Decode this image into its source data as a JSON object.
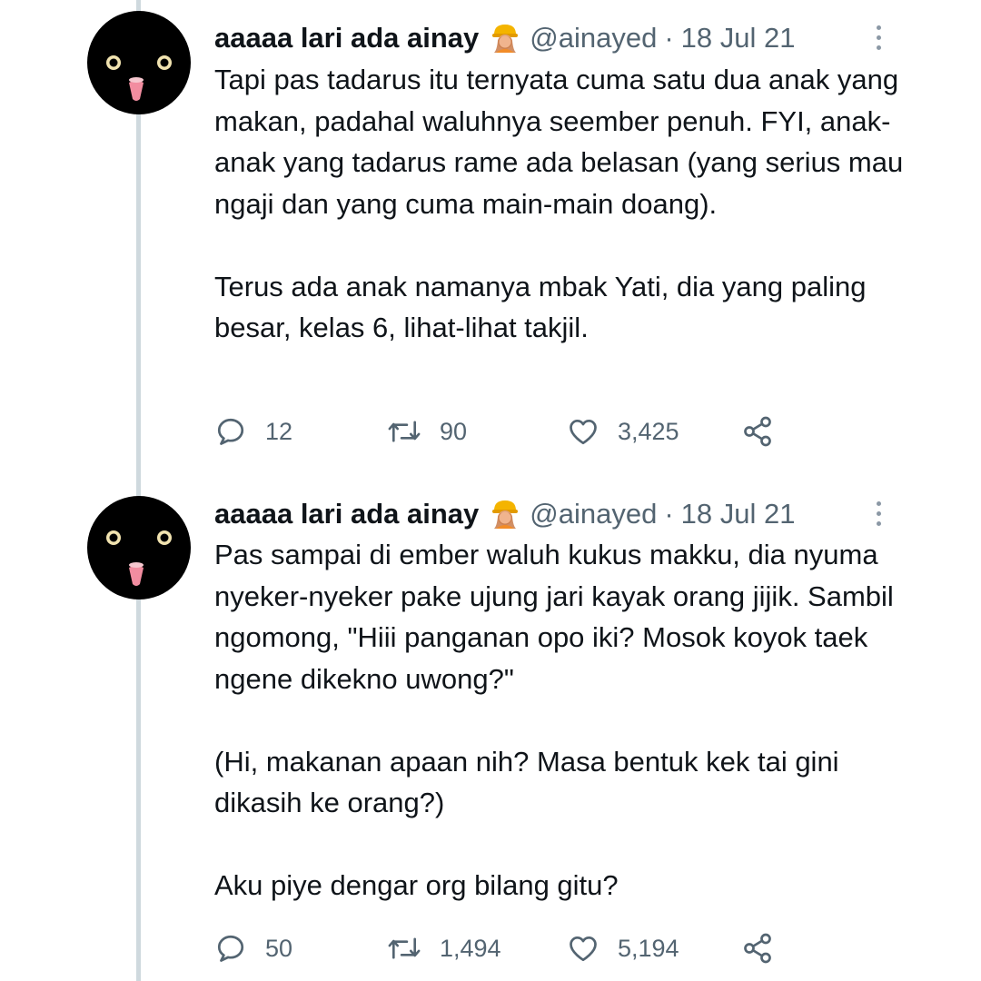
{
  "tweets": [
    {
      "author_name": "aaaaa lari ada ainay",
      "handle": "@ainayed",
      "separator": "·",
      "date": "18 Jul 21",
      "paragraphs": [
        "Tapi pas tadarus itu ternyata cuma satu dua anak yang makan, padahal waluhnya seember penuh. FYI, anak-anak yang tadarus rame ada belasan (yang serius mau ngaji dan yang cuma main-main doang).",
        "Terus ada anak namanya mbak Yati, dia yang paling besar, kelas 6, lihat-lihat takjil."
      ],
      "replies": "12",
      "retweets": "90",
      "likes": "3,425"
    },
    {
      "author_name": "aaaaa lari ada ainay",
      "handle": "@ainayed",
      "separator": "·",
      "date": "18 Jul 21",
      "paragraphs": [
        "Pas sampai di ember waluh kukus makku, dia nyuma nyeker-nyeker pake ujung jari kayak orang jijik. Sambil ngomong, \"Hiii panganan opo iki? Mosok koyok taek ngene dikekno uwong?\"",
        "(Hi, makanan apaan nih? Masa bentuk kek tai gini dikasih ke orang?)",
        "Aku piye dengar org bilang gitu?"
      ],
      "replies": "50",
      "retweets": "1,494",
      "likes": "5,194"
    }
  ],
  "icons": {
    "avatar": "black-face-avatar",
    "emoji": "construction-worker-emoji",
    "more": "more-vertical-icon",
    "reply": "reply-icon",
    "retweet": "retweet-icon",
    "like": "heart-icon",
    "share": "share-icon"
  },
  "colors": {
    "text": "#0f1419",
    "secondary": "#536471",
    "thread_line": "#cfd9de"
  }
}
